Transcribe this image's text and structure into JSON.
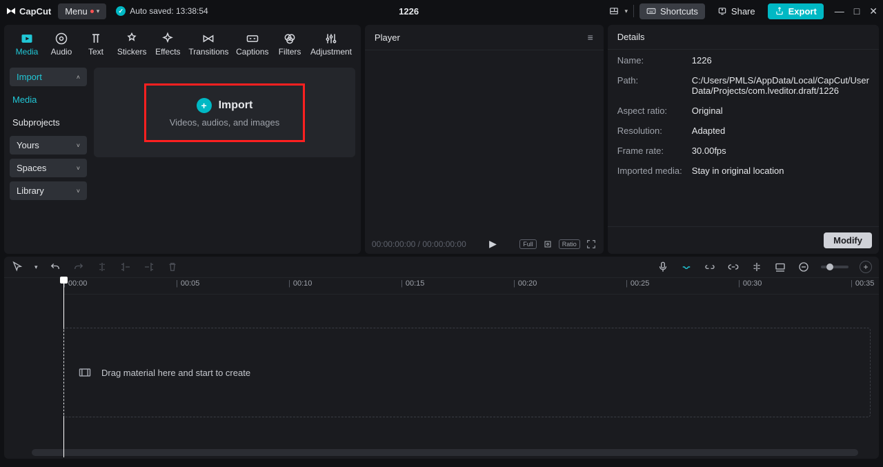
{
  "titlebar": {
    "app_name": "CapCut",
    "menu_label": "Menu",
    "autosave": "Auto saved: 13:38:54",
    "project_title": "1226",
    "shortcuts": "Shortcuts",
    "share": "Share",
    "export": "Export"
  },
  "tabs": {
    "media": "Media",
    "audio": "Audio",
    "text": "Text",
    "stickers": "Stickers",
    "effects": "Effects",
    "transitions": "Transitions",
    "captions": "Captions",
    "filters": "Filters",
    "adjustment": "Adjustment"
  },
  "sidebar": {
    "import": "Import",
    "media": "Media",
    "subprojects": "Subprojects",
    "yours": "Yours",
    "spaces": "Spaces",
    "library": "Library"
  },
  "import_area": {
    "title": "Import",
    "subtitle": "Videos, audios, and images"
  },
  "player": {
    "title": "Player",
    "time_left": "00:00:00:00",
    "time_sep": " / ",
    "time_right": "00:00:00:00",
    "full": "Full",
    "ratio": "Ratio"
  },
  "details": {
    "title": "Details",
    "rows": {
      "name_l": "Name:",
      "name_v": "1226",
      "path_l": "Path:",
      "path_v": "C:/Users/PMLS/AppData/Local/CapCut/User Data/Projects/com.lveditor.draft/1226",
      "aspect_l": "Aspect ratio:",
      "aspect_v": "Original",
      "res_l": "Resolution:",
      "res_v": "Adapted",
      "fps_l": "Frame rate:",
      "fps_v": "30.00fps",
      "imp_l": "Imported media:",
      "imp_v": "Stay in original location"
    },
    "modify": "Modify"
  },
  "timeline": {
    "ticks": [
      "00:00",
      "00:05",
      "00:10",
      "00:15",
      "00:20",
      "00:25",
      "00:30",
      "00:35"
    ],
    "drop_hint": "Drag material here and start to create"
  }
}
